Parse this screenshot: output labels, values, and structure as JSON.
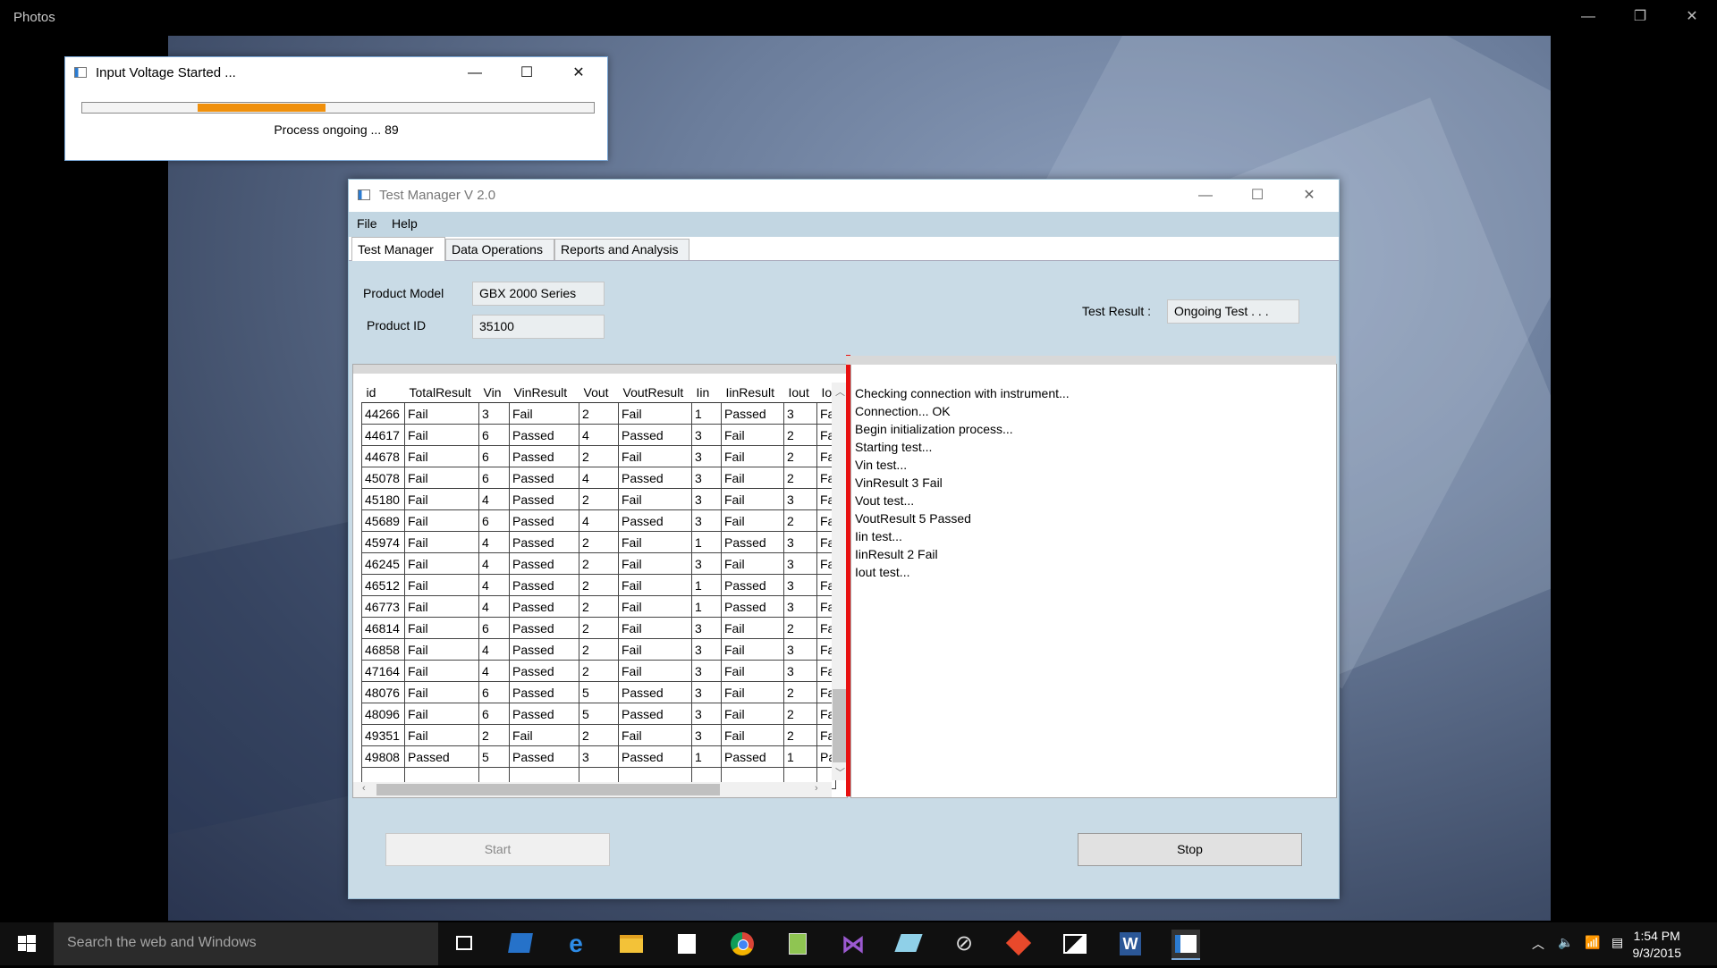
{
  "photos": {
    "title": "Photos",
    "minimize_glyph": "—",
    "restore_glyph": "❐",
    "close_glyph": "✕"
  },
  "progress_window": {
    "title": "Input Voltage Started ...",
    "progress_segment_start": 0.225,
    "progress_segment_end": 0.475,
    "progress_color": "#f0900c",
    "status_text": "Process ongoing ...  89"
  },
  "main_window": {
    "title": "Test Manager V 2.0",
    "menu": [
      "File",
      "Help"
    ],
    "tabs": [
      "Test Manager",
      "Data Operations",
      "Reports and Analysis"
    ],
    "product_model_label": "Product Model",
    "product_model_value": "GBX 2000 Series",
    "product_id_label": "Product ID",
    "product_id_value": "35100",
    "test_result_label": "Test Result :",
    "test_result_value": "Ongoing Test . . .",
    "grid_columns": [
      "id",
      "TotalResult",
      "Vin",
      "VinResult",
      "Vout",
      "VoutResult",
      "Iin",
      "IinResult",
      "Iout",
      "Io"
    ],
    "grid_rows": [
      [
        "44266",
        "Fail",
        "3",
        "Fail",
        "2",
        "Fail",
        "1",
        "Passed",
        "3",
        "Fa"
      ],
      [
        "44617",
        "Fail",
        "6",
        "Passed",
        "4",
        "Passed",
        "3",
        "Fail",
        "2",
        "Fa"
      ],
      [
        "44678",
        "Fail",
        "6",
        "Passed",
        "2",
        "Fail",
        "3",
        "Fail",
        "2",
        "Fa"
      ],
      [
        "45078",
        "Fail",
        "6",
        "Passed",
        "4",
        "Passed",
        "3",
        "Fail",
        "2",
        "Fa"
      ],
      [
        "45180",
        "Fail",
        "4",
        "Passed",
        "2",
        "Fail",
        "3",
        "Fail",
        "3",
        "Fa"
      ],
      [
        "45689",
        "Fail",
        "6",
        "Passed",
        "4",
        "Passed",
        "3",
        "Fail",
        "2",
        "Fa"
      ],
      [
        "45974",
        "Fail",
        "4",
        "Passed",
        "2",
        "Fail",
        "1",
        "Passed",
        "3",
        "Fa"
      ],
      [
        "46245",
        "Fail",
        "4",
        "Passed",
        "2",
        "Fail",
        "3",
        "Fail",
        "3",
        "Fa"
      ],
      [
        "46512",
        "Fail",
        "4",
        "Passed",
        "2",
        "Fail",
        "1",
        "Passed",
        "3",
        "Fa"
      ],
      [
        "46773",
        "Fail",
        "4",
        "Passed",
        "2",
        "Fail",
        "1",
        "Passed",
        "3",
        "Fa"
      ],
      [
        "46814",
        "Fail",
        "6",
        "Passed",
        "2",
        "Fail",
        "3",
        "Fail",
        "2",
        "Fa"
      ],
      [
        "46858",
        "Fail",
        "4",
        "Passed",
        "2",
        "Fail",
        "3",
        "Fail",
        "3",
        "Fa"
      ],
      [
        "47164",
        "Fail",
        "4",
        "Passed",
        "2",
        "Fail",
        "3",
        "Fail",
        "3",
        "Fa"
      ],
      [
        "48076",
        "Fail",
        "6",
        "Passed",
        "5",
        "Passed",
        "3",
        "Fail",
        "2",
        "Fa"
      ],
      [
        "48096",
        "Fail",
        "6",
        "Passed",
        "5",
        "Passed",
        "3",
        "Fail",
        "2",
        "Fa"
      ],
      [
        "49351",
        "Fail",
        "2",
        "Fail",
        "2",
        "Fail",
        "3",
        "Fail",
        "2",
        "Fa"
      ],
      [
        "49808",
        "Passed",
        "5",
        "Passed",
        "3",
        "Passed",
        "1",
        "Passed",
        "1",
        "Pa"
      ],
      [
        "",
        "",
        "",
        "",
        "",
        "",
        "",
        "",
        "",
        ""
      ]
    ],
    "log_lines": [
      "Checking connection with instrument...",
      "Connection... OK",
      "Begin initialization process...",
      "Starting test...",
      "Vin test...",
      "VinResult 3 Fail",
      "Vout test...",
      "VoutResult 5 Passed",
      "Iin test...",
      "IinResult 2 Fail",
      "Iout test..."
    ],
    "start_button": "Start",
    "stop_button": "Stop"
  },
  "taskbar": {
    "search_placeholder": "Search the web and Windows",
    "time": "1:54 PM",
    "date": "9/3/2015",
    "pinned": [
      "task-view-icon",
      "powershell-icon",
      "edge-icon",
      "file-explorer-icon",
      "store-icon",
      "chrome-icon",
      "notepad-plus-icon",
      "visual-studio-icon",
      "azure-icon",
      "satellite-icon",
      "git-icon",
      "photos-icon",
      "word-icon",
      "app-icon"
    ]
  }
}
